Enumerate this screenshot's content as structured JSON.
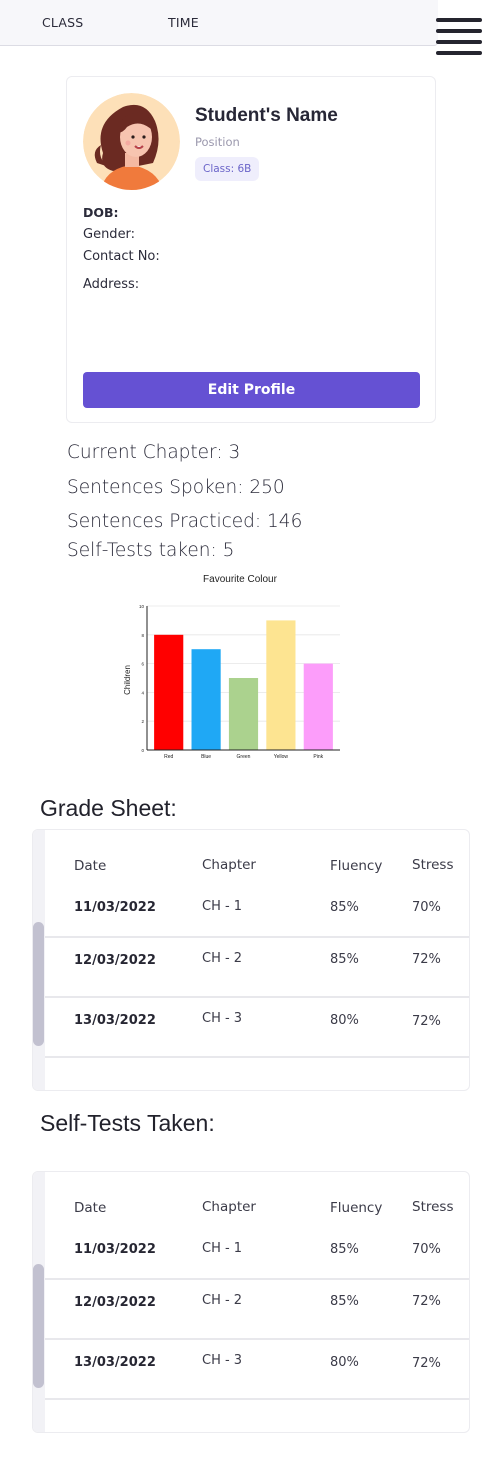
{
  "nav": {
    "tabs": [
      "CLASS",
      "TIME"
    ]
  },
  "profile": {
    "name": "Student's Name",
    "position": "Position",
    "class_badge": "Class: 6B",
    "dob_label": "DOB:",
    "gender_label": "Gender:",
    "contact_label": "Contact No:",
    "address_label": "Address:",
    "edit_button": "Edit Profile"
  },
  "stats": {
    "current_chapter": "Current Chapter: 3",
    "sentences_spoken": "Sentences Spoken: 250",
    "sentences_practiced": "Sentences Practiced: 146",
    "self_tests": "Self-Tests taken: 5"
  },
  "chart_data": {
    "type": "bar",
    "title": "Favourite Colour",
    "xlabel": "",
    "ylabel": "Children",
    "categories": [
      "Red",
      "Blue",
      "Green",
      "Yellow",
      "Pink"
    ],
    "values": [
      8,
      7,
      5,
      9,
      6
    ],
    "colors": [
      "#ff0000",
      "#1fa8f5",
      "#abd28e",
      "#fde491",
      "#fc9dfa"
    ],
    "ylim": [
      0,
      10
    ],
    "yticks": [
      "0",
      "2",
      "4",
      "6",
      "8",
      "10"
    ],
    "grid": true
  },
  "grade_sheet": {
    "title": "Grade Sheet:",
    "headers": [
      "Date",
      "Chapter",
      "Fluency",
      "Stress"
    ],
    "rows": [
      [
        "11/03/2022",
        "CH - 1",
        "85%",
        "70%"
      ],
      [
        "12/03/2022",
        "CH - 2",
        "85%",
        "72%"
      ],
      [
        "13/03/2022",
        "CH - 3",
        "80%",
        "72%"
      ]
    ]
  },
  "self_tests_table": {
    "title": "Self-Tests Taken:",
    "headers": [
      "Date",
      "Chapter",
      "Fluency",
      "Stress"
    ],
    "rows": [
      [
        "11/03/2022",
        "CH - 1",
        "85%",
        "70%"
      ],
      [
        "12/03/2022",
        "CH - 2",
        "85%",
        "72%"
      ],
      [
        "13/03/2022",
        "CH - 3",
        "80%",
        "72%"
      ]
    ]
  }
}
